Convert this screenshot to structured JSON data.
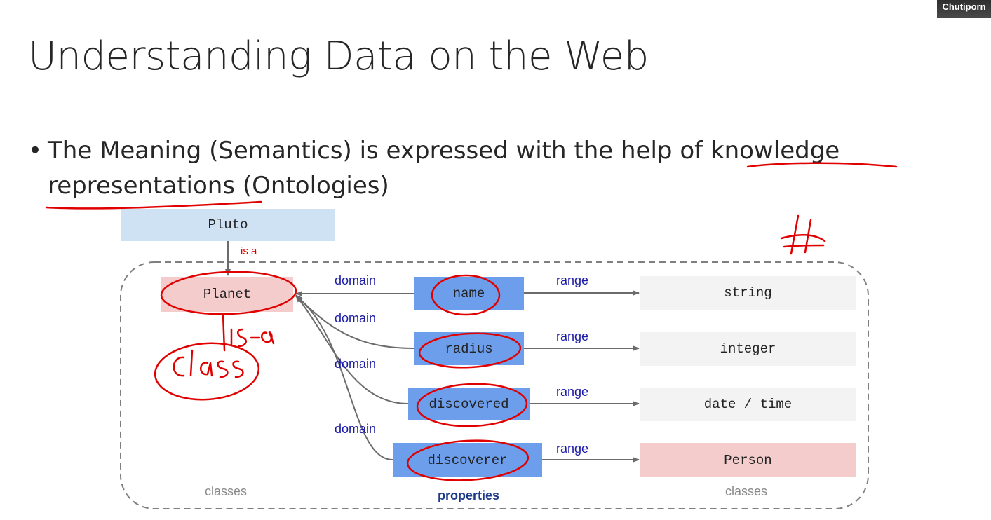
{
  "participant": {
    "name": "Chutiporn"
  },
  "slide": {
    "title": "Understanding Data on the Web",
    "bullet_symbol": "•",
    "bullet_line1": "The Meaning (Semantics) is expressed with the help of knowledge",
    "bullet_line2": "representations (Ontologies)"
  },
  "diagram": {
    "instance": "Pluto",
    "is_a_label": "is a",
    "class_node": "Planet",
    "properties": [
      "name",
      "radius",
      "discovered",
      "discoverer"
    ],
    "domain_label": "domain",
    "range_label": "range",
    "ranges": [
      "string",
      "integer",
      "date / time",
      "Person"
    ],
    "group_labels": {
      "left": "classes",
      "middle": "properties",
      "right": "classes"
    }
  },
  "annotations": {
    "handwritten_is_a": "is-a",
    "handwritten_class": "class",
    "handwritten_hash": "#"
  },
  "colors": {
    "instance_fill": "#cfe2f3",
    "class_fill": "#f4cccc",
    "property_fill": "#6d9eeb",
    "range_fill": "#f3f3f3",
    "annotation_red": "#e00000",
    "domain_range_text": "#1a1aa6"
  }
}
